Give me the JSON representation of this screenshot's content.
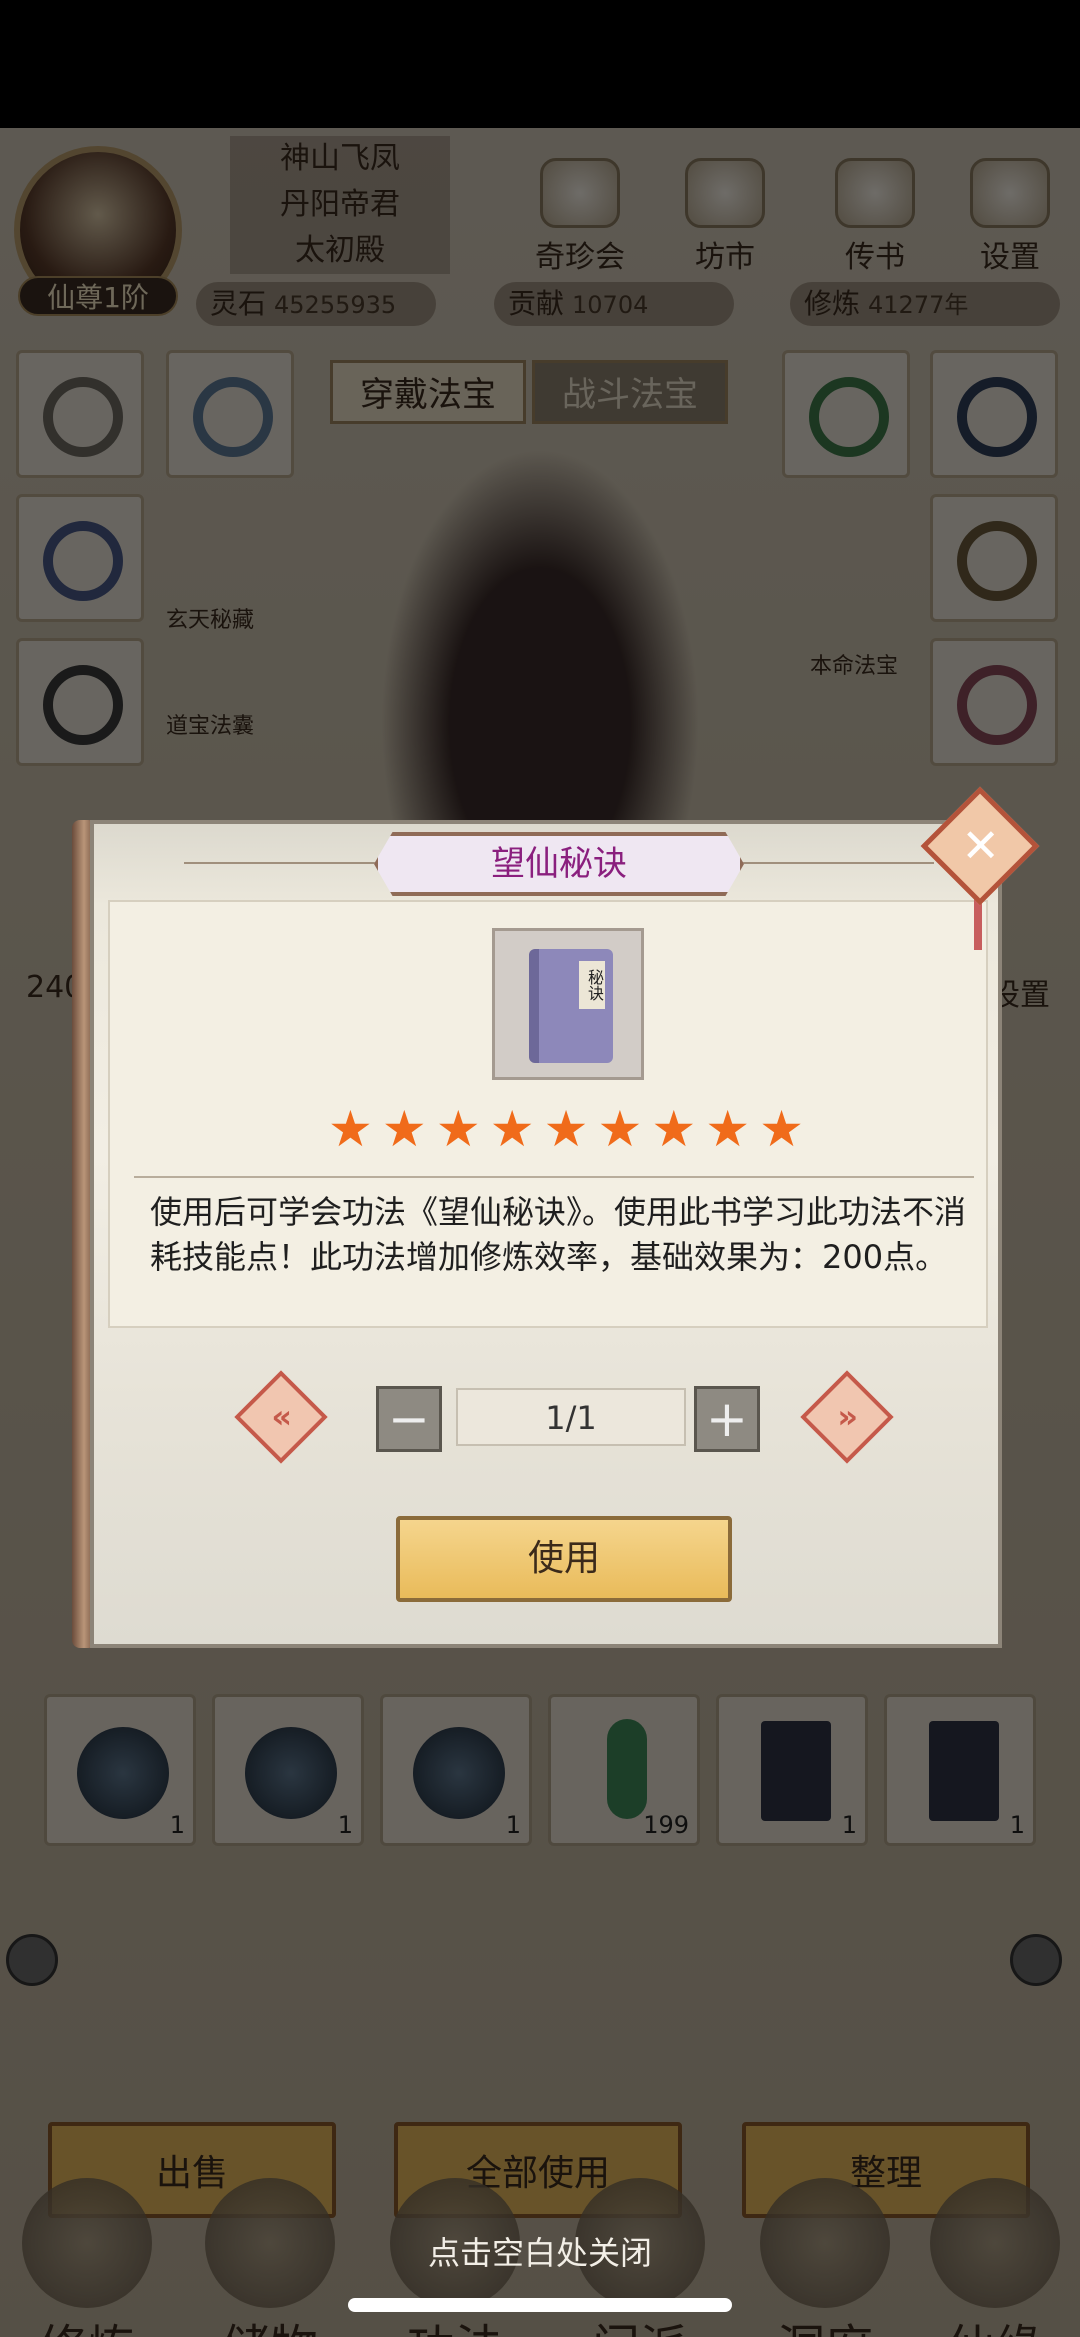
{
  "player": {
    "rank": "仙尊1阶",
    "titles": [
      "神山飞凤",
      "丹阳帝君",
      "太初殿"
    ]
  },
  "top_buttons": [
    "奇珍会",
    "坊市",
    "传书",
    "设置"
  ],
  "resources": [
    {
      "label": "灵石",
      "value": "45255935"
    },
    {
      "label": "贡献",
      "value": "10704"
    },
    {
      "label": "修炼",
      "value": "41277年"
    }
  ],
  "equip_tabs": [
    "穿戴法宝",
    "战斗法宝"
  ],
  "side_labels": [
    "玄天秘藏",
    "道宝法囊",
    "本命法宝"
  ],
  "bag_left_count": "240",
  "bag_right_label": "设置",
  "bag_row": [
    {
      "kind": "orb",
      "count": "1"
    },
    {
      "kind": "orb",
      "count": "1"
    },
    {
      "kind": "orb",
      "count": "1"
    },
    {
      "kind": "gem",
      "count": "199"
    },
    {
      "kind": "book",
      "count": "1"
    },
    {
      "kind": "book",
      "count": "1"
    }
  ],
  "actions": [
    "出售",
    "全部使用",
    "整理"
  ],
  "bottom_nav": [
    "修炼",
    "储物",
    "功法",
    "门派",
    "洞府",
    "仙缘"
  ],
  "modal": {
    "title": "望仙秘诀",
    "close_icon": "close-icon",
    "item_label": "秘诀",
    "star_count": 9,
    "stars": [
      "★",
      "★",
      "★",
      "★",
      "★",
      "★",
      "★",
      "★",
      "★"
    ],
    "description": "使用后可学会功法《望仙秘诀》。使用此书学习此功法不消耗技能点！此功法增加修炼效率，基础效果为：200点。",
    "quantity": "1/1",
    "use_label": "使用"
  },
  "hint": "点击空白处关闭",
  "colors": {
    "title_text": "#8a1f7e",
    "star": "#f06b1a",
    "button": "#e9bb5a",
    "close_border": "#b4533a"
  }
}
